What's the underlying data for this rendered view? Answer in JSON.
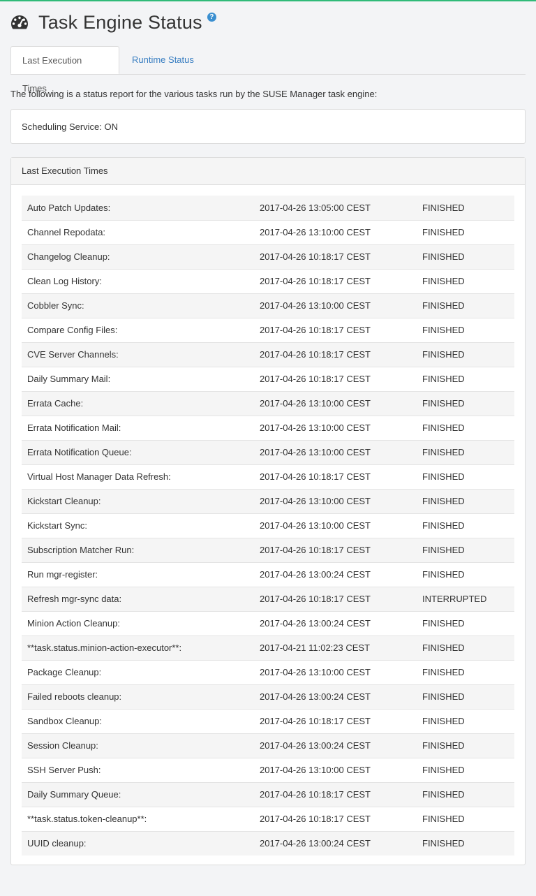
{
  "page": {
    "title": "Task Engine Status",
    "help_icon": "?",
    "accent_color": "#30ba78",
    "link_color": "#3a7fc2"
  },
  "tabs": [
    {
      "label": "Last Execution Times",
      "active": true
    },
    {
      "label": "Runtime Status",
      "active": false
    }
  ],
  "intro": "The following is a status report for the various tasks run by the SUSE Manager task engine:",
  "scheduling": {
    "text": "Scheduling Service: ON"
  },
  "panel": {
    "heading": "Last Execution Times"
  },
  "tasks": [
    {
      "name": "Auto Patch Updates:",
      "time": "2017-04-26 13:05:00 CEST",
      "status": "FINISHED"
    },
    {
      "name": "Channel Repodata:",
      "time": "2017-04-26 13:10:00 CEST",
      "status": "FINISHED"
    },
    {
      "name": "Changelog Cleanup:",
      "time": "2017-04-26 10:18:17 CEST",
      "status": "FINISHED"
    },
    {
      "name": "Clean Log History:",
      "time": "2017-04-26 10:18:17 CEST",
      "status": "FINISHED"
    },
    {
      "name": "Cobbler Sync:",
      "time": "2017-04-26 13:10:00 CEST",
      "status": "FINISHED"
    },
    {
      "name": "Compare Config Files:",
      "time": "2017-04-26 10:18:17 CEST",
      "status": "FINISHED"
    },
    {
      "name": "CVE Server Channels:",
      "time": "2017-04-26 10:18:17 CEST",
      "status": "FINISHED"
    },
    {
      "name": "Daily Summary Mail:",
      "time": "2017-04-26 10:18:17 CEST",
      "status": "FINISHED"
    },
    {
      "name": "Errata Cache:",
      "time": "2017-04-26 13:10:00 CEST",
      "status": "FINISHED"
    },
    {
      "name": "Errata Notification Mail:",
      "time": "2017-04-26 13:10:00 CEST",
      "status": "FINISHED"
    },
    {
      "name": "Errata Notification Queue:",
      "time": "2017-04-26 13:10:00 CEST",
      "status": "FINISHED"
    },
    {
      "name": "Virtual Host Manager Data Refresh:",
      "time": "2017-04-26 10:18:17 CEST",
      "status": "FINISHED"
    },
    {
      "name": "Kickstart Cleanup:",
      "time": "2017-04-26 13:10:00 CEST",
      "status": "FINISHED"
    },
    {
      "name": "Kickstart Sync:",
      "time": "2017-04-26 13:10:00 CEST",
      "status": "FINISHED"
    },
    {
      "name": "Subscription Matcher Run:",
      "time": "2017-04-26 10:18:17 CEST",
      "status": "FINISHED"
    },
    {
      "name": "Run mgr-register:",
      "time": "2017-04-26 13:00:24 CEST",
      "status": "FINISHED"
    },
    {
      "name": "Refresh mgr-sync data:",
      "time": "2017-04-26 10:18:17 CEST",
      "status": "INTERRUPTED"
    },
    {
      "name": "Minion Action Cleanup:",
      "time": "2017-04-26 13:00:24 CEST",
      "status": "FINISHED"
    },
    {
      "name": "**task.status.minion-action-executor**:",
      "time": "2017-04-21 11:02:23 CEST",
      "status": "FINISHED"
    },
    {
      "name": "Package Cleanup:",
      "time": "2017-04-26 13:10:00 CEST",
      "status": "FINISHED"
    },
    {
      "name": "Failed reboots cleanup:",
      "time": "2017-04-26 13:00:24 CEST",
      "status": "FINISHED"
    },
    {
      "name": "Sandbox Cleanup:",
      "time": "2017-04-26 10:18:17 CEST",
      "status": "FINISHED"
    },
    {
      "name": "Session Cleanup:",
      "time": "2017-04-26 13:00:24 CEST",
      "status": "FINISHED"
    },
    {
      "name": "SSH Server Push:",
      "time": "2017-04-26 13:10:00 CEST",
      "status": "FINISHED"
    },
    {
      "name": "Daily Summary Queue:",
      "time": "2017-04-26 10:18:17 CEST",
      "status": "FINISHED"
    },
    {
      "name": "**task.status.token-cleanup**:",
      "time": "2017-04-26 10:18:17 CEST",
      "status": "FINISHED"
    },
    {
      "name": "UUID cleanup:",
      "time": "2017-04-26 13:00:24 CEST",
      "status": "FINISHED"
    }
  ]
}
